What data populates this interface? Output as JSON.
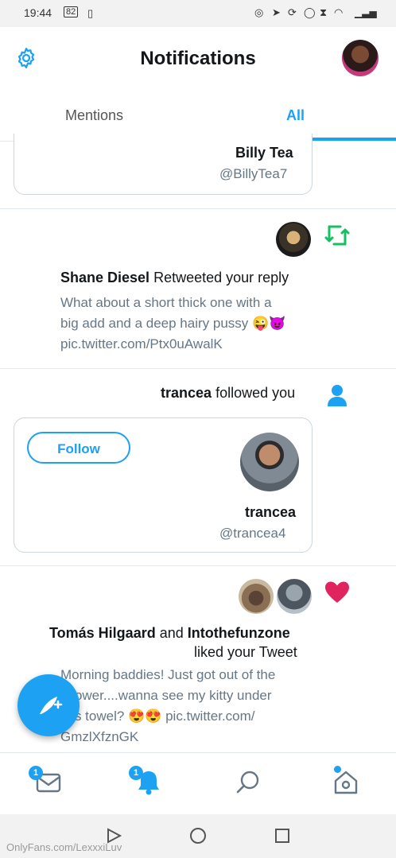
{
  "status_bar": {
    "time": "19:44",
    "battery": "82"
  },
  "header": {
    "title": "Notifications"
  },
  "tabs": [
    {
      "label": "All"
    },
    {
      "label": "Mentions"
    }
  ],
  "card_top": {
    "name": "Billy Tea",
    "handle": "@BillyTea7"
  },
  "retweet_notification": {
    "actor": "Shane Diesel",
    "action": "Retweeted your reply",
    "text_lines": [
      "What about a short thick one with a",
      "big add and a deep hairy pussy 😜😈",
      "pic.twitter.com/Ptx0uAwalK"
    ]
  },
  "follow_notification": {
    "actor": "trancea",
    "action": "followed you",
    "card_name": "trancea",
    "card_handle": "@trancea4",
    "follow_label": "Follow"
  },
  "like_notification": {
    "actor1": "Tomás Hilgaard",
    "and_word": "and",
    "actor2": "Intothefunzone",
    "action": "liked your Tweet",
    "text_lines": [
      "Morning baddies! Just got out of the",
      "shower....wanna see my kitty under",
      "this towel? 😍😍 pic.twitter.com/",
      "GmzlXfznGK"
    ]
  },
  "bottom_nav": {
    "messages_badge": "1",
    "notifications_badge": "1"
  },
  "watermark": "OnlyFans.com/LexxxiLuv",
  "colors": {
    "accent": "#1da1f2",
    "retweet": "#17bf63",
    "like": "#e0245e"
  }
}
